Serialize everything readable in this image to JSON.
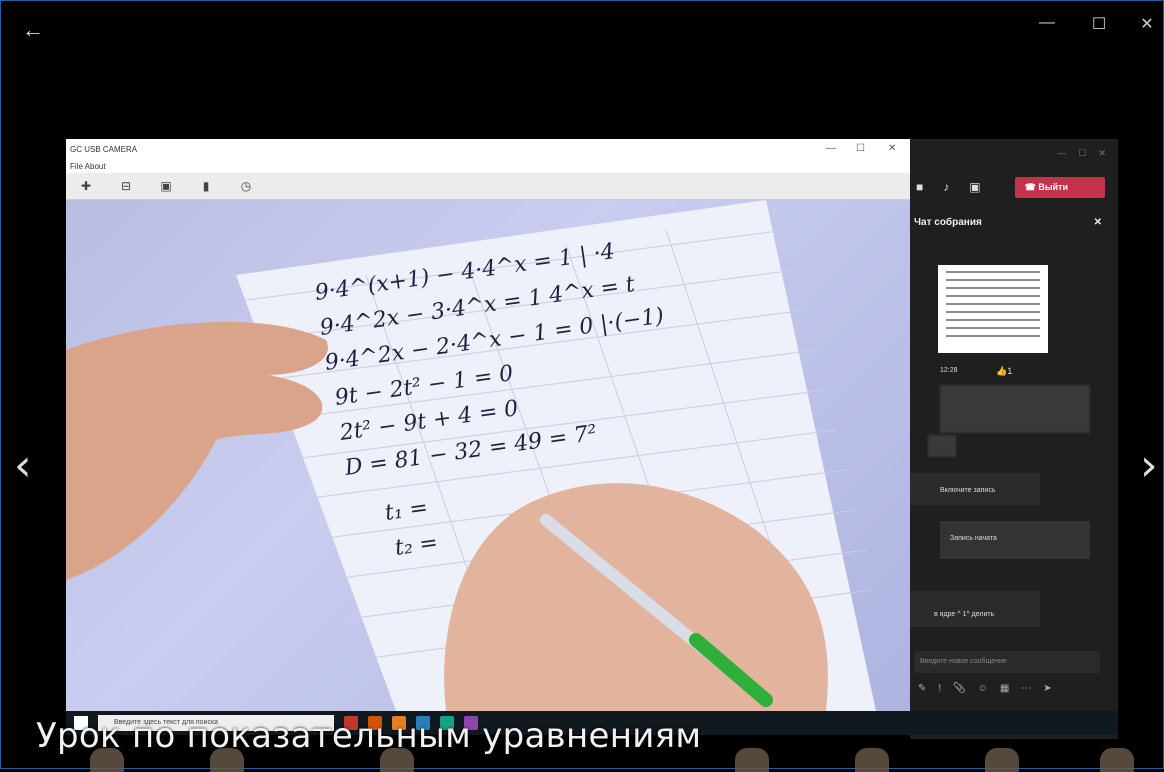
{
  "viewer": {
    "back_icon": "arrow-left-icon",
    "controls": {
      "minimize": "—",
      "maximize": "☐",
      "close": "✕"
    },
    "prev_icon": "chevron-left-icon",
    "next_icon": "chevron-right-icon",
    "caption": "Урок по показательным уравнениям"
  },
  "camera_window": {
    "title": "GC USB CAMERA",
    "menu": "File   About",
    "controls": {
      "minimize": "—",
      "maximize": "☐",
      "close": "✕"
    },
    "toolbar": [
      {
        "icon": "settings-icon",
        "glyph": "✚"
      },
      {
        "icon": "capture-icon",
        "glyph": "⊟"
      },
      {
        "icon": "record-icon",
        "glyph": "▣"
      },
      {
        "icon": "folder-icon",
        "glyph": "▮"
      },
      {
        "icon": "timer-icon",
        "glyph": "◷"
      }
    ],
    "handwriting": [
      "9·4^(x+1) − 4·4^x = 1   | ·4",
      "9·4^2x − 3·4^x = 1   4^x = t",
      "9·4^2x − 2·4^x − 1 = 0   |·(−1)",
      "9t − 2t² − 1 = 0",
      "2t² − 9t + 4 = 0",
      "D = 81 − 32 = 49 = 7²",
      "t₁ =",
      "t₂ ="
    ]
  },
  "teams": {
    "controls": {
      "minimize": "—",
      "maximize": "☐",
      "close": "✕"
    },
    "leave_label": "Выйти",
    "chat_title": "Чат собрания",
    "chat_close": "✕",
    "sender_time": "12:28",
    "reaction": "👍1",
    "recording_notice": "Включите запись",
    "recording_reply": "Запись начата",
    "last_message": "в ядре ^ 1^ делить",
    "compose_placeholder": "Введите новое сообщение",
    "compose_tools": [
      "✎",
      "!",
      "📎",
      "☺",
      "▦",
      "⋯",
      "➤"
    ]
  },
  "taskbar": {
    "search_placeholder": "Введите здесь текст для поиска",
    "app_colors": [
      "#c0392b",
      "#d35400",
      "#e67e22",
      "#2980b9",
      "#16a085",
      "#8e44ad"
    ]
  }
}
